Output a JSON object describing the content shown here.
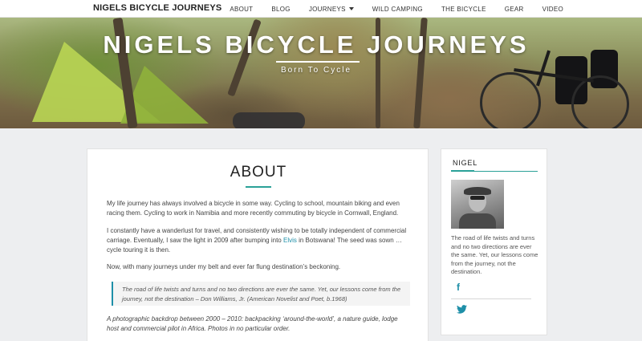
{
  "site": {
    "brand": "NIGELS BICYCLE JOURNEYS"
  },
  "nav": {
    "items": [
      "ABOUT",
      "BLOG",
      "JOURNEYS",
      "WILD CAMPING",
      "THE BICYCLE",
      "GEAR",
      "VIDEO"
    ]
  },
  "hero": {
    "title": "NIGELS BICYCLE JOURNEYS",
    "subtitle": "Born To Cycle"
  },
  "main": {
    "title": "ABOUT",
    "p1": "My life journey has always involved a bicycle in some way. Cycling to school, mountain biking and even racing them. Cycling to work in Namibia and more recently commuting by bicycle in Cornwall, England.",
    "p2_before": "I constantly have a wanderlust for travel, and consistently wishing to be totally independent of commercial carriage. Eventually, I saw the light in 2009 after bumping into ",
    "p2_link": "Elvis",
    "p2_after": " in Botswana! The seed was sown … cycle touring it is then.",
    "p3": "Now, with many journeys under my belt and ever far flung destination’s beckoning.",
    "quote": "The road of life twists and turns and no two directions are ever the same. Yet, our lessons come from the journey, not the destination – Don Williams, Jr. (American Novelist and Poet, b.1968)",
    "p4": "A photographic backdrop between 2000 – 2010: backpacking ‘around-the-world’, a nature guide, lodge host and commercial pilot in Africa. Photos in no particular order."
  },
  "sidebar": {
    "title": "NIGEL",
    "text": "The road of life twists and turns and no two directions are ever the same. Yet, our lessons come from the journey, not the destination.",
    "social": [
      {
        "icon": "facebook-icon",
        "glyph": "f"
      },
      {
        "icon": "twitter-icon",
        "glyph": "🐦"
      }
    ]
  },
  "colors": {
    "accent": "#2aa198",
    "link": "#1e8fa8",
    "background": "#edeef0"
  }
}
